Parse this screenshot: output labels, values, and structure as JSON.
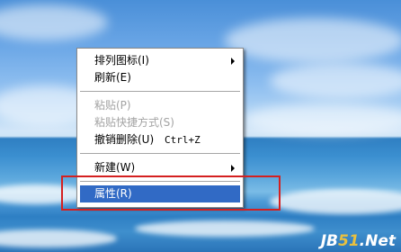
{
  "context_menu": {
    "items": [
      {
        "label": "排列图标(I)",
        "shortcut": "",
        "submenu": true,
        "disabled": false
      },
      {
        "label": "刷新(E)",
        "shortcut": "",
        "submenu": false,
        "disabled": false
      },
      {
        "label": "粘贴(P)",
        "shortcut": "",
        "submenu": false,
        "disabled": true
      },
      {
        "label": "粘贴快捷方式(S)",
        "shortcut": "",
        "submenu": false,
        "disabled": true
      },
      {
        "label": "撤销删除(U)",
        "shortcut": "Ctrl+Z",
        "submenu": false,
        "disabled": false
      },
      {
        "label": "新建(W)",
        "shortcut": "",
        "submenu": true,
        "disabled": false
      },
      {
        "label": "属性(R)",
        "shortcut": "",
        "submenu": false,
        "disabled": false,
        "selected": true
      }
    ]
  },
  "watermark": {
    "part1": "JB",
    "part2": "51",
    "part3": ".Net"
  },
  "colors": {
    "selection": "#316ac5",
    "highlight_box": "#d42020",
    "disabled_text": "#a3a3a3"
  }
}
